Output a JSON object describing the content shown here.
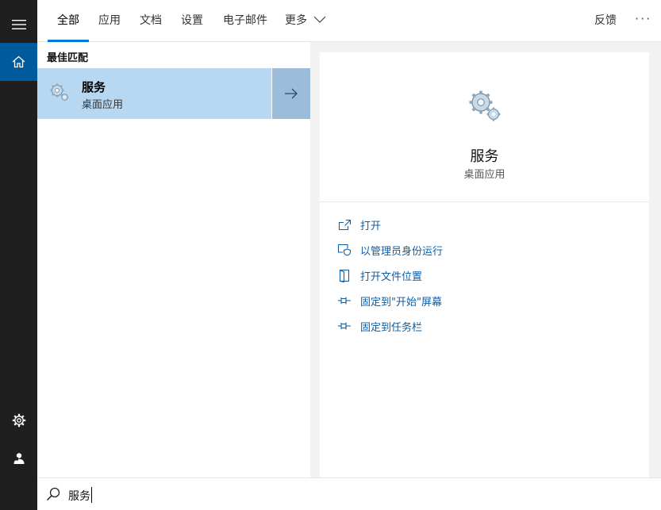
{
  "tabs": [
    {
      "label": "全部",
      "active": true
    },
    {
      "label": "应用",
      "active": false
    },
    {
      "label": "文档",
      "active": false
    },
    {
      "label": "设置",
      "active": false
    },
    {
      "label": "电子邮件",
      "active": false
    },
    {
      "label": "更多",
      "active": false
    }
  ],
  "topbar": {
    "feedback_label": "反馈",
    "more_options_label": "···"
  },
  "results": {
    "section_label": "最佳匹配",
    "best_match": {
      "title": "服务",
      "subtitle": "桌面应用",
      "icon": "gears-icon"
    }
  },
  "preview": {
    "title": "服务",
    "subtitle": "桌面应用",
    "icon": "gears-icon",
    "actions": [
      {
        "label": "打开",
        "icon": "open-icon"
      },
      {
        "label": "以管理员身份运行",
        "icon": "admin-shield-icon"
      },
      {
        "label": "打开文件位置",
        "icon": "file-location-icon"
      },
      {
        "label": "固定到\"开始\"屏幕",
        "icon": "pin-icon"
      },
      {
        "label": "固定到任务栏",
        "icon": "pin-icon"
      }
    ]
  },
  "search": {
    "value": "服务"
  },
  "colors": {
    "accent": "#0078d7",
    "rail_background": "#1f1f1f",
    "home_active": "#005a9e",
    "selected_item": "#b8d8f2",
    "link": "#0a5fa8"
  }
}
